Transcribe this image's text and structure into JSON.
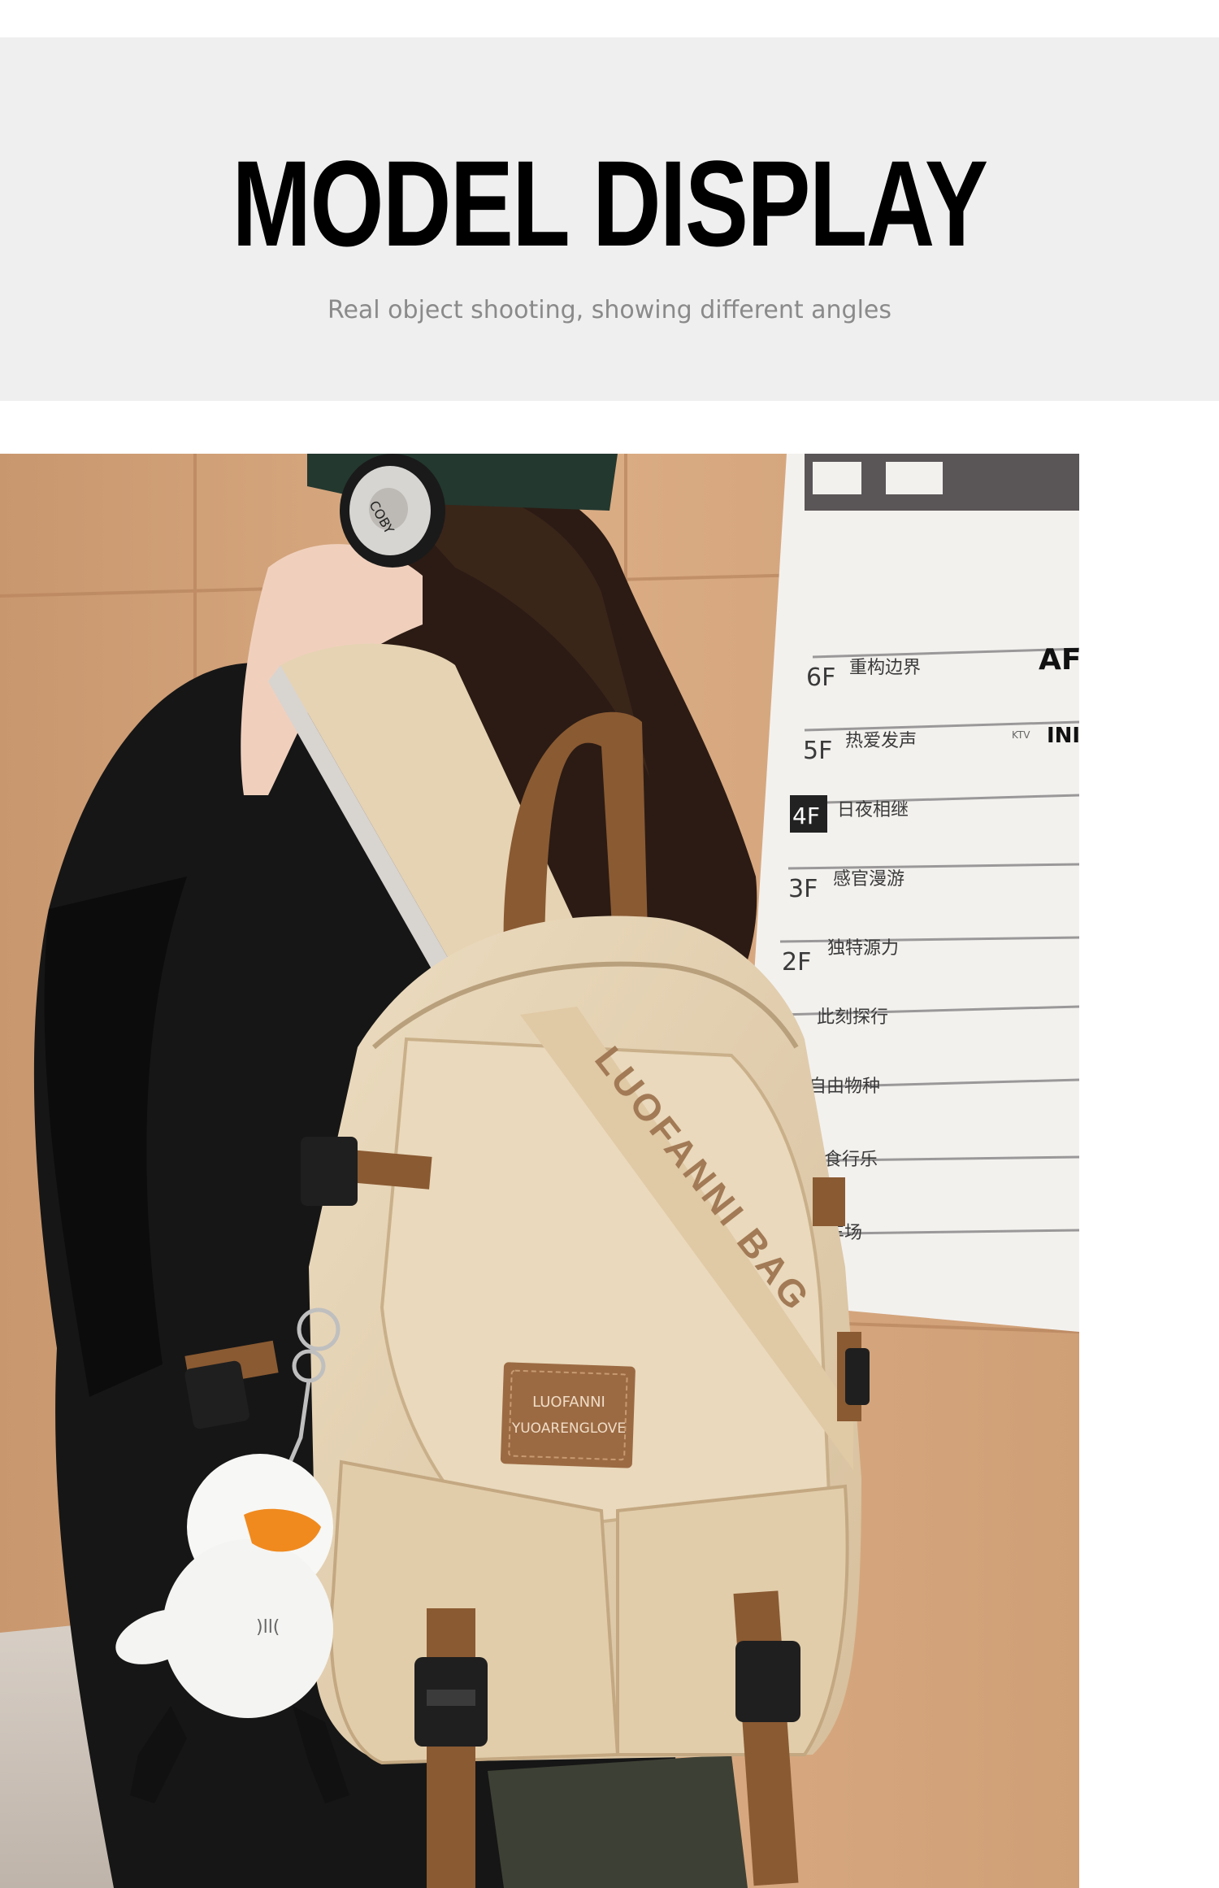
{
  "header": {
    "title": "MODEL DISPLAY",
    "subtitle": "Real object shooting, showing different angles"
  },
  "photo": {
    "bag_text": "LUOFANNI BAG",
    "patch_line1": "LUOFANNI",
    "patch_line2": "YUOARENGLOVE",
    "headphone_brand": "COBY",
    "directory": {
      "floors": [
        "6F",
        "5F",
        "4F",
        "3F",
        "2F"
      ],
      "labels": [
        "重构边界",
        "热爱发声",
        "日夜相继",
        "感官漫游",
        "独特源力",
        "此刻探行",
        "自由物种",
        "美食行乐",
        "停车场"
      ],
      "brand_partial": "AF",
      "brand_partial2": "INI",
      "ktv": "KTV"
    },
    "colors": {
      "wall": "#d9aa82",
      "bag": "#e3cfb0",
      "strap": "#8a5a32",
      "jacket": "#151515"
    }
  }
}
